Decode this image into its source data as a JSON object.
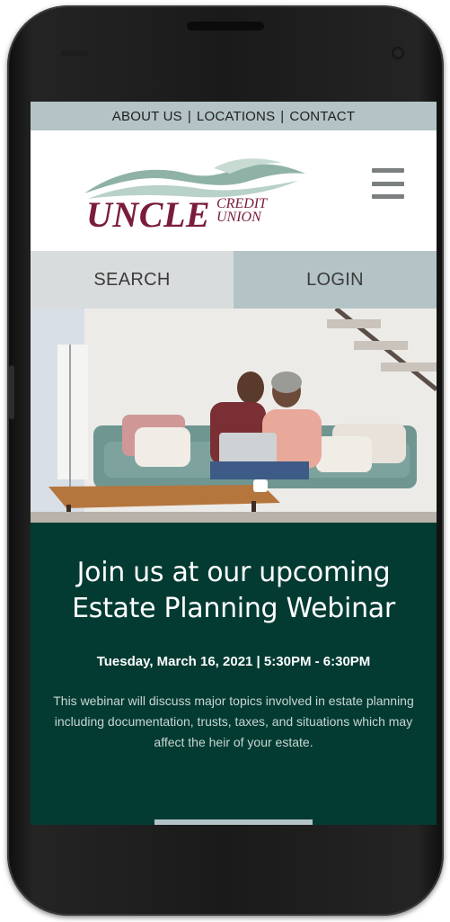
{
  "topnav": {
    "items": [
      "ABOUT US",
      "LOCATIONS",
      "CONTACT"
    ],
    "separator": "|"
  },
  "brand": {
    "name": "UNCLE",
    "sub_line1": "CREDIT",
    "sub_line2": "UNION",
    "primary_color": "#7a1d3a",
    "accent_color": "#a8c4bb"
  },
  "header": {
    "menu_icon": "hamburger-menu-icon"
  },
  "tabs": [
    {
      "label": "SEARCH"
    },
    {
      "label": "LOGIN"
    }
  ],
  "promo": {
    "title": "Join us at our upcoming Estate Planning Webinar",
    "date": "Tuesday, March 16, 2021 | 5:30PM - 6:30PM",
    "description": "This webinar will discuss major topics involved in estate planning including documentation, trusts, taxes, and situations which may affect the heir of your estate.",
    "background_color": "#033b32"
  },
  "colors": {
    "nav_bg": "#b4c3c6",
    "search_tab_bg": "#d9dcdd"
  }
}
